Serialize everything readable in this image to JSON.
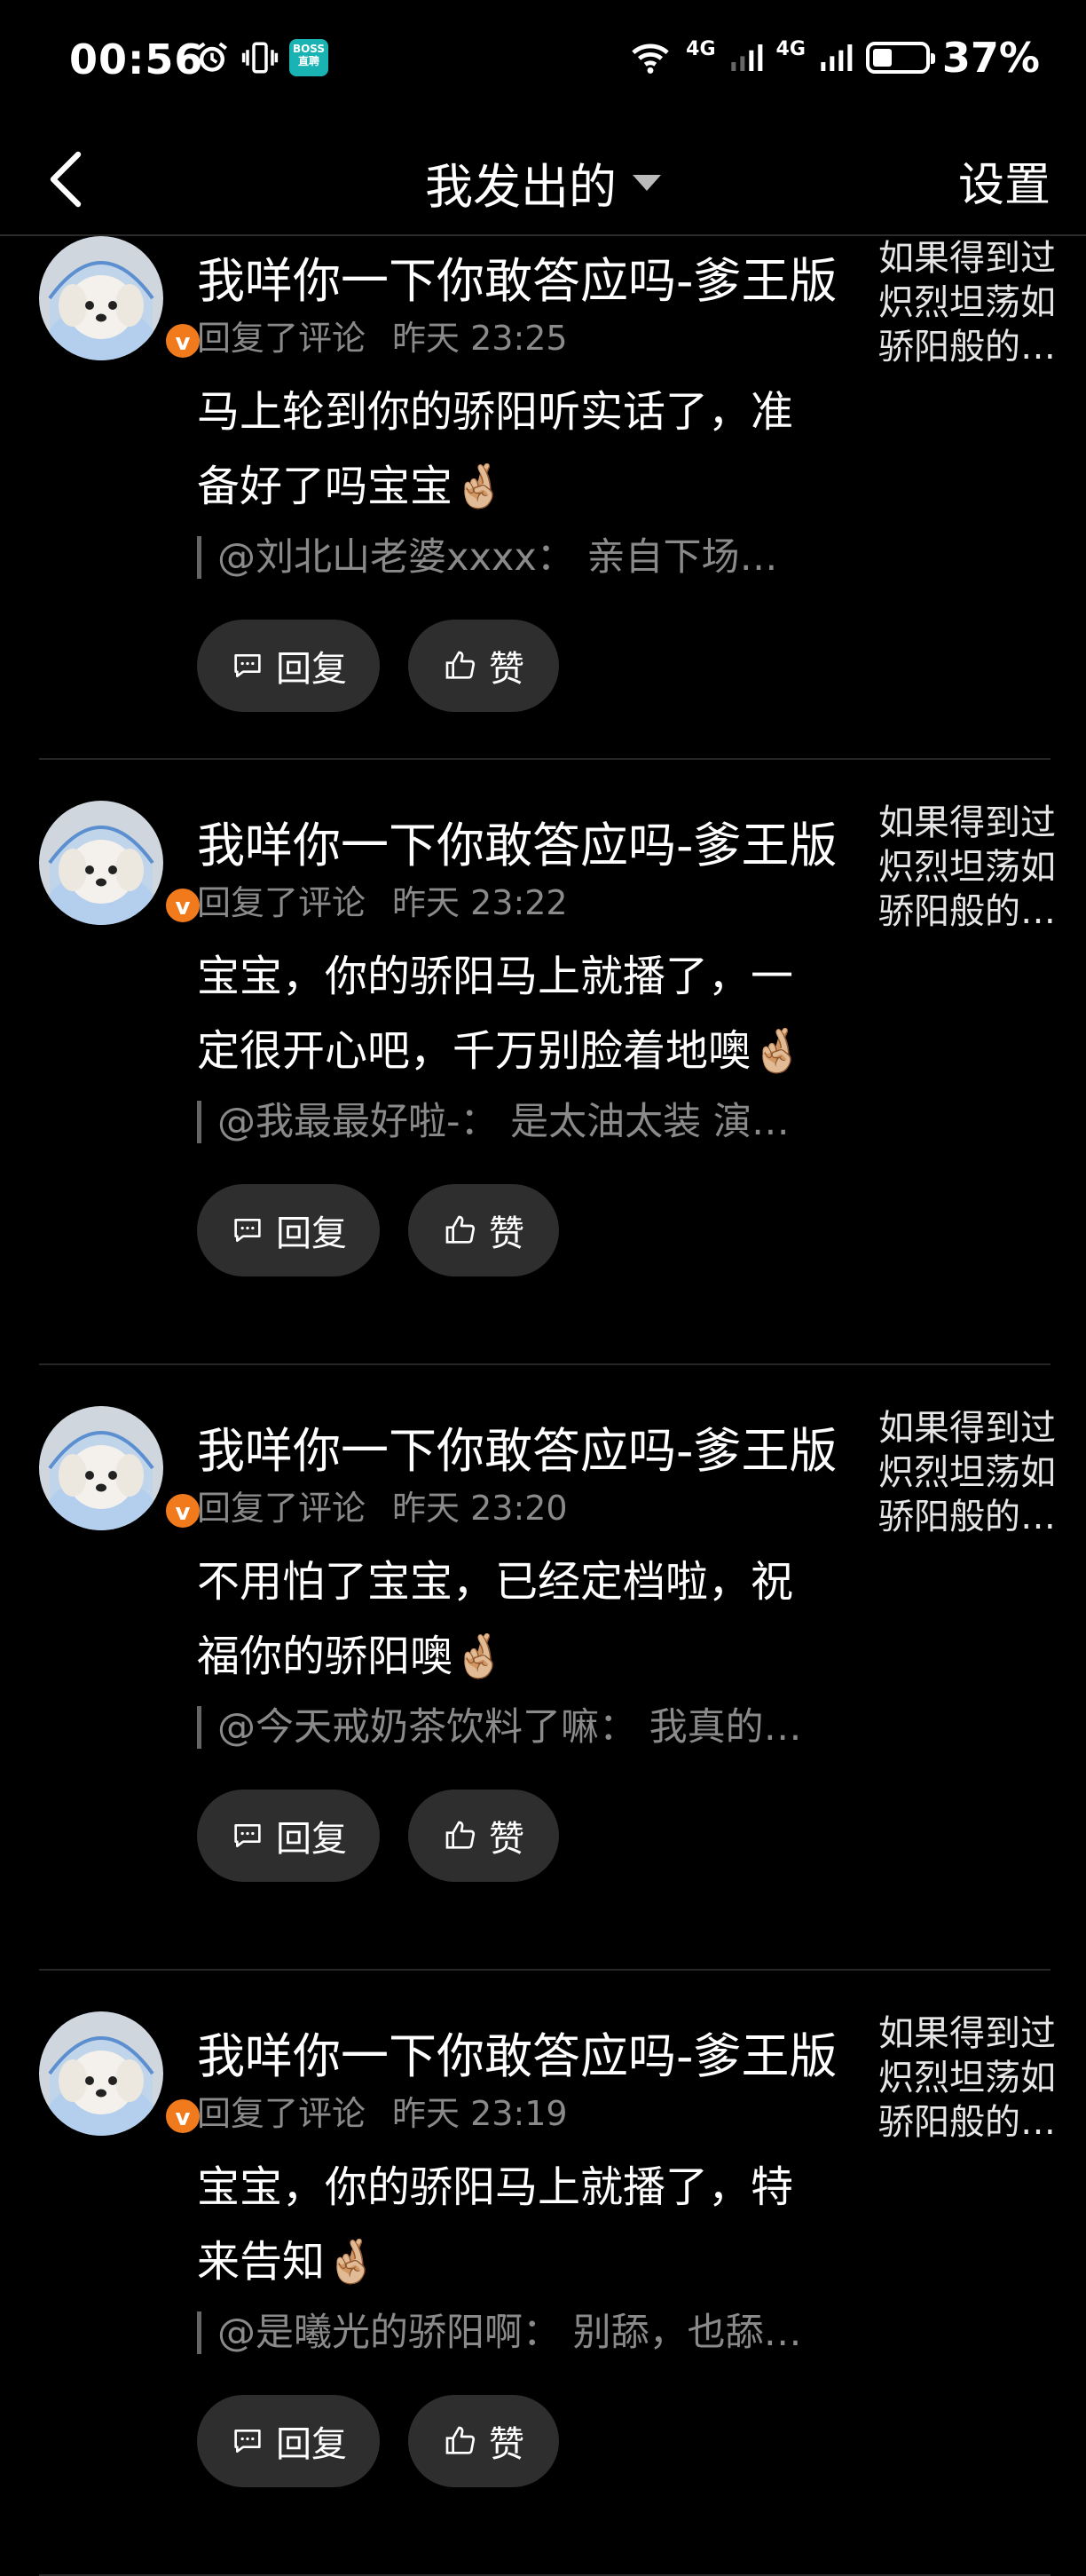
{
  "status_bar": {
    "time": "00:56",
    "boss_badge": "BOSS 直聘",
    "network_1": "4G",
    "network_2": "4G",
    "battery_percent": "37%",
    "battery_level": 0.37,
    "icons": [
      "alarm-icon",
      "vibrate-icon",
      "boss-app-icon",
      "wifi-icon",
      "signal-icon",
      "battery-icon"
    ]
  },
  "header": {
    "title": "我发出的",
    "settings": "设置"
  },
  "items": [
    {
      "video_title": "我咩你一下你敢答应吗-爹王版",
      "action": "回复了评论",
      "time": "昨天 23:25",
      "comment": "马上轮到你的骄阳听实话了，准备好了吗宝宝🤞🏼",
      "quote": "@刘北山老婆xxxx： 亲自下场…",
      "side_text": "如果得到过炽烈坦荡如骄阳般的…",
      "reply_label": "回复",
      "like_label": "赞"
    },
    {
      "video_title": "我咩你一下你敢答应吗-爹王版",
      "action": "回复了评论",
      "time": "昨天 23:22",
      "comment": "宝宝，你的骄阳马上就播了，一定很开心吧，千万别脸着地噢🤞🏼",
      "quote": "@我最最好啦-： 是太油太装 演…",
      "side_text": "如果得到过炽烈坦荡如骄阳般的…",
      "reply_label": "回复",
      "like_label": "赞"
    },
    {
      "video_title": "我咩你一下你敢答应吗-爹王版",
      "action": "回复了评论",
      "time": "昨天 23:20",
      "comment": "不用怕了宝宝，已经定档啦，祝福你的骄阳噢🤞🏼",
      "quote": "@今天戒奶茶饮料了嘛： 我真的…",
      "side_text": "如果得到过炽烈坦荡如骄阳般的…",
      "reply_label": "回复",
      "like_label": "赞"
    },
    {
      "video_title": "我咩你一下你敢答应吗-爹王版",
      "action": "回复了评论",
      "time": "昨天 23:19",
      "comment": "宝宝，你的骄阳马上就播了，特来告知🤞🏼",
      "quote": "@是曦光的骄阳啊： 别舔，也舔…",
      "side_text": "如果得到过炽烈坦荡如骄阳般的…",
      "reply_label": "回复",
      "like_label": "赞"
    }
  ]
}
